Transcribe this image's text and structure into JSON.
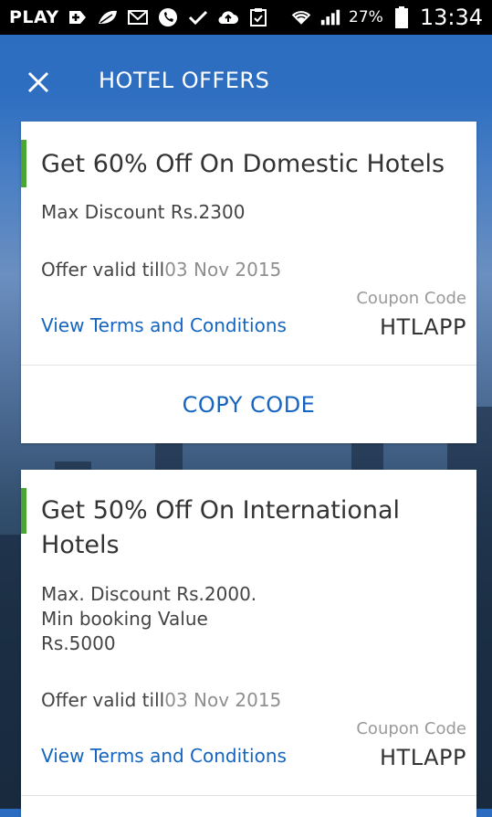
{
  "status_bar": {
    "carrier": "PLAY",
    "battery_percent": "27%",
    "time": "13:34",
    "icons": [
      "add-icon",
      "leaf-icon",
      "mail-icon",
      "phone-icon",
      "check-icon",
      "cloud-upload-icon",
      "clipboard-icon",
      "wifi-icon",
      "signal-icon",
      "battery-icon"
    ]
  },
  "header": {
    "title": "HOTEL OFFERS",
    "close_icon": "close-icon"
  },
  "colors": {
    "accent_green": "#4aa632",
    "link_blue": "#1565c0",
    "header_blue": "#2b6cc0"
  },
  "offers": [
    {
      "title": "Get 60% Off On Domestic Hotels",
      "description": [
        "Max Discount Rs.2300"
      ],
      "valid_label": "Offer valid till",
      "valid_date": "03 Nov 2015",
      "coupon_label": "Coupon Code",
      "coupon_code": "HTLAPP",
      "terms_link": "View Terms and Conditions",
      "copy_button": "COPY CODE"
    },
    {
      "title": "Get 50% Off On International Hotels",
      "description": [
        "Max. Discount Rs.2000.",
        "Min booking Value",
        "Rs.5000"
      ],
      "valid_label": "Offer valid till",
      "valid_date": "03 Nov 2015",
      "coupon_label": "Coupon Code",
      "coupon_code": "HTLAPP",
      "terms_link": "View Terms and Conditions"
    }
  ]
}
